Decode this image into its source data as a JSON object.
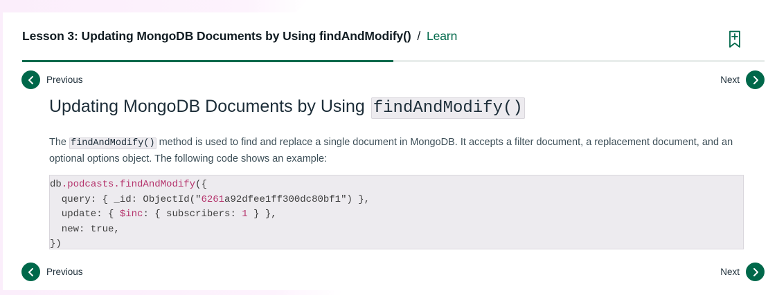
{
  "header": {
    "lesson_title": "Lesson 3: Updating MongoDB Documents by Using findAndModify()",
    "separator": "/",
    "learn_link": "Learn"
  },
  "progress": {
    "fraction": 0.5
  },
  "nav": {
    "previous_label": "Previous",
    "next_label": "Next"
  },
  "content": {
    "title_text": "Updating MongoDB Documents by Using",
    "title_code": "findAndModify()",
    "para_before": "The",
    "para_code": "findAndModify()",
    "para_after": "method is used to find and replace a single document in MongoDB. It accepts a filter document, a replacement document, and an optional options object. The following code shows an example:"
  },
  "code": {
    "l1_obj": "db",
    "l1_call": ".podcasts.findAndModify",
    "l1_open": "({",
    "l2_a": "  query: { _id: ObjectId(\"",
    "l2_num": "6261",
    "l2_b": "a92dfee1ff300dc80bf1\") },",
    "l3_a": "  update: { ",
    "l3_op": "$inc",
    "l3_b": ": { subscribers: ",
    "l3_num": "1",
    "l3_c": " } },",
    "l4": "  new: true,",
    "l5": "})"
  },
  "colors": {
    "accent": "#00684a",
    "code_bg": "#edebef",
    "token_pink": "#b5326b"
  },
  "icons": {
    "bookmark": "bookmark-add-icon",
    "prev": "chevron-left-icon",
    "next": "chevron-right-icon"
  }
}
